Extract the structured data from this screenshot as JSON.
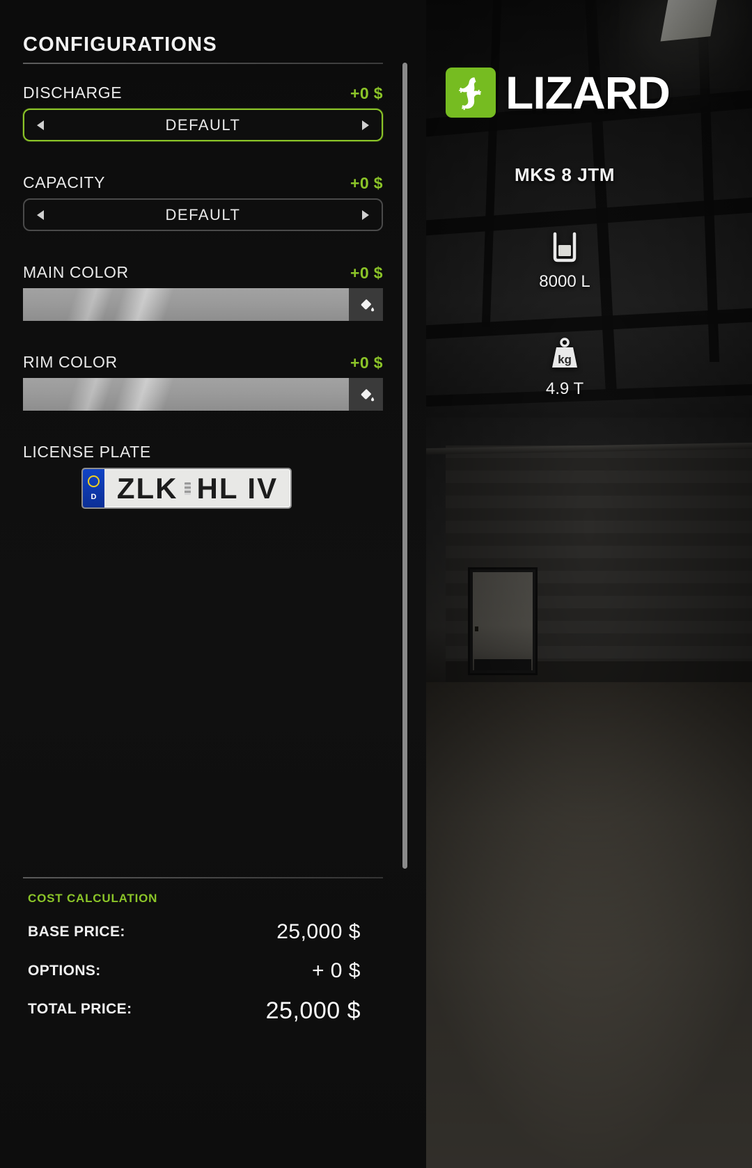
{
  "panel": {
    "title": "CONFIGURATIONS",
    "config_rows": [
      {
        "label": "DISCHARGE",
        "price": "+0 $",
        "value": "DEFAULT",
        "type": "selector",
        "focused": true
      },
      {
        "label": "CAPACITY",
        "price": "+0 $",
        "value": "DEFAULT",
        "type": "selector",
        "focused": false
      },
      {
        "label": "MAIN COLOR",
        "price": "+0 $",
        "value": "",
        "type": "color",
        "focused": false
      },
      {
        "label": "RIM COLOR",
        "price": "+0 $",
        "value": "",
        "type": "color",
        "focused": false
      }
    ],
    "license": {
      "label": "LICENSE PLATE",
      "country_code": "D",
      "prefix": "ZLK",
      "suffix": "HL IV",
      "full_text": "ZLK HL IV"
    }
  },
  "cost": {
    "title": "COST CALCULATION",
    "rows": [
      {
        "label": "BASE PRICE:",
        "value": "25,000 $"
      },
      {
        "label": "OPTIONS:",
        "value": "+ 0 $"
      },
      {
        "label": "TOTAL PRICE:",
        "value": "25,000 $"
      }
    ]
  },
  "vehicle": {
    "brand": "LIZARD",
    "model": "MKS 8 JTM",
    "specs": [
      {
        "icon": "tank-icon",
        "value": "8000 L"
      },
      {
        "icon": "weight-icon",
        "value": "4.9 T"
      }
    ]
  },
  "colors": {
    "accent_green": "#8bc428",
    "brand_green": "#76bc21",
    "swatch_silver": "#9a9a9a",
    "plate_blue": "#1144c4"
  }
}
